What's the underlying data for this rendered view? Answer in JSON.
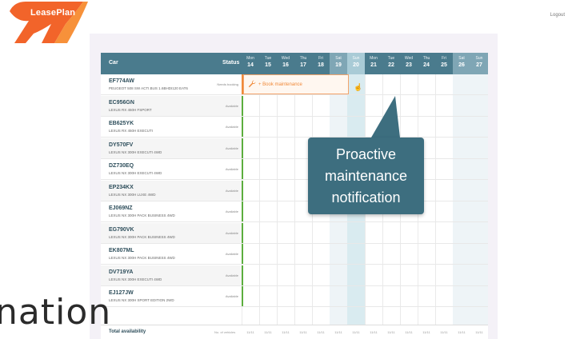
{
  "app": {
    "logo_text": "LeasePlan",
    "logout_label": "Logout"
  },
  "grid": {
    "col_car": "Car",
    "col_status": "Status",
    "days": [
      {
        "name": "Mon",
        "date": "14",
        "weekend": false
      },
      {
        "name": "Tue",
        "date": "15",
        "weekend": false
      },
      {
        "name": "Wed",
        "date": "16",
        "weekend": false
      },
      {
        "name": "Thu",
        "date": "17",
        "weekend": false
      },
      {
        "name": "Fri",
        "date": "18",
        "weekend": false
      },
      {
        "name": "Sat",
        "date": "19",
        "weekend": true
      },
      {
        "name": "Sun",
        "date": "20",
        "weekend": true,
        "selected": true
      },
      {
        "name": "Mon",
        "date": "21",
        "weekend": false
      },
      {
        "name": "Tue",
        "date": "22",
        "weekend": false
      },
      {
        "name": "Wed",
        "date": "23",
        "weekend": false
      },
      {
        "name": "Thu",
        "date": "24",
        "weekend": false
      },
      {
        "name": "Fri",
        "date": "25",
        "weekend": false
      },
      {
        "name": "Sat",
        "date": "26",
        "weekend": true
      },
      {
        "name": "Sun",
        "date": "27",
        "weekend": true
      }
    ],
    "rows": [
      {
        "plate": "EF774AW",
        "model": "PEUGEOT 508 SW ACTI.BUS 1.6BHDI120 EAT6",
        "status": "Needs booking"
      },
      {
        "plate": "EC956GN",
        "model": "LEXUS RX 450H FSPORT",
        "status": "Available"
      },
      {
        "plate": "EB625YK",
        "model": "LEXUS RX 450H EXECUTI",
        "status": "Available"
      },
      {
        "plate": "DY570FV",
        "model": "LEXUS NX 300H EXECUTI 4WD",
        "status": "Available"
      },
      {
        "plate": "DZ730EQ",
        "model": "LEXUS NX 300H EXECUTI 4WD",
        "status": "Available"
      },
      {
        "plate": "EP234KX",
        "model": "LEXUS NX 300H LUXE 4WD",
        "status": "Available"
      },
      {
        "plate": "EJ069NZ",
        "model": "LEXUS NX 300H PACK BUSINESS 4WD",
        "status": "Available"
      },
      {
        "plate": "EG790VK",
        "model": "LEXUS NX 300H PACK BUSINESS 4WD",
        "status": "Available"
      },
      {
        "plate": "EK807ML",
        "model": "LEXUS NX 300H PACK BUSINESS 4WD",
        "status": "Available"
      },
      {
        "plate": "DV719YA",
        "model": "LEXUS NX 300H EXECUTI 4WD",
        "status": "Available"
      },
      {
        "plate": "EJ127JW",
        "model": "LEXUS NX 300H SPORT EDITION 2WD",
        "status": "Available"
      }
    ],
    "booking_label": "+ Book maintenance",
    "total_label": "Total availability",
    "total_sub": "No. of vehicles",
    "total_value": "11/11"
  },
  "callout": {
    "line1": "Proactive",
    "line2": "maintenance",
    "line3": "notification"
  },
  "overlay_word": "nation",
  "colors": {
    "header": "#4a7b8d",
    "accent": "#f08a3a",
    "callout": "#3d6e7f",
    "available": "#5cae3e",
    "logo": "#f2642a"
  },
  "icons": [
    "wrench-icon",
    "hand-cursor-icon"
  ]
}
